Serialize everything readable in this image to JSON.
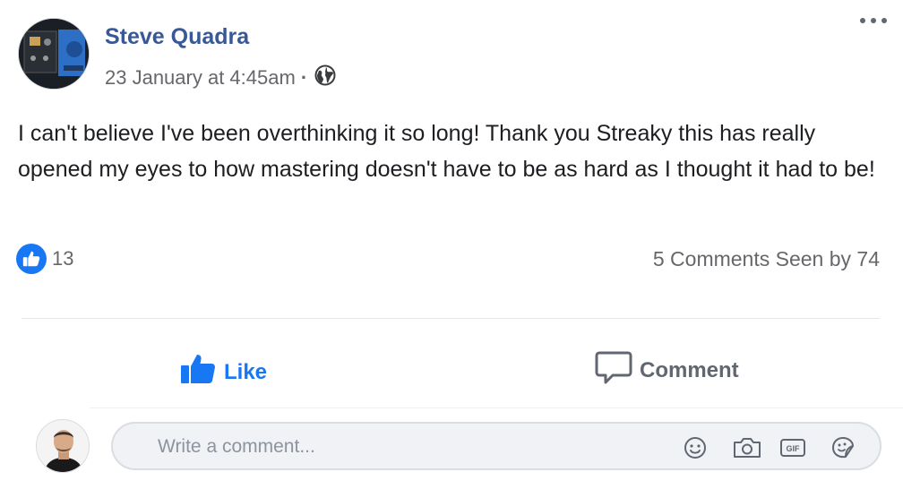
{
  "post": {
    "author": "Steve Quadra",
    "timestamp": "23 January at 4:45am",
    "separator": "·",
    "privacy_icon": "globe-icon",
    "body": "I can't believe I've been overthinking it so long! Thank you Streaky this has really opened my eyes to how mastering doesn't have to be as hard as I thought it had to be!",
    "menu_icon": "more-options-icon"
  },
  "reactions": {
    "icon": "like-reaction-icon",
    "count": "13",
    "stats": "5 Comments Seen by 74"
  },
  "actions": {
    "like_label": "Like",
    "comment_label": "Comment"
  },
  "composer": {
    "placeholder": "Write a comment...",
    "icons": [
      "emoji-icon",
      "camera-icon",
      "gif-icon",
      "sticker-icon"
    ]
  },
  "colors": {
    "link_blue": "#385898",
    "accent_blue": "#1877f2",
    "meta_gray": "#65676b"
  }
}
